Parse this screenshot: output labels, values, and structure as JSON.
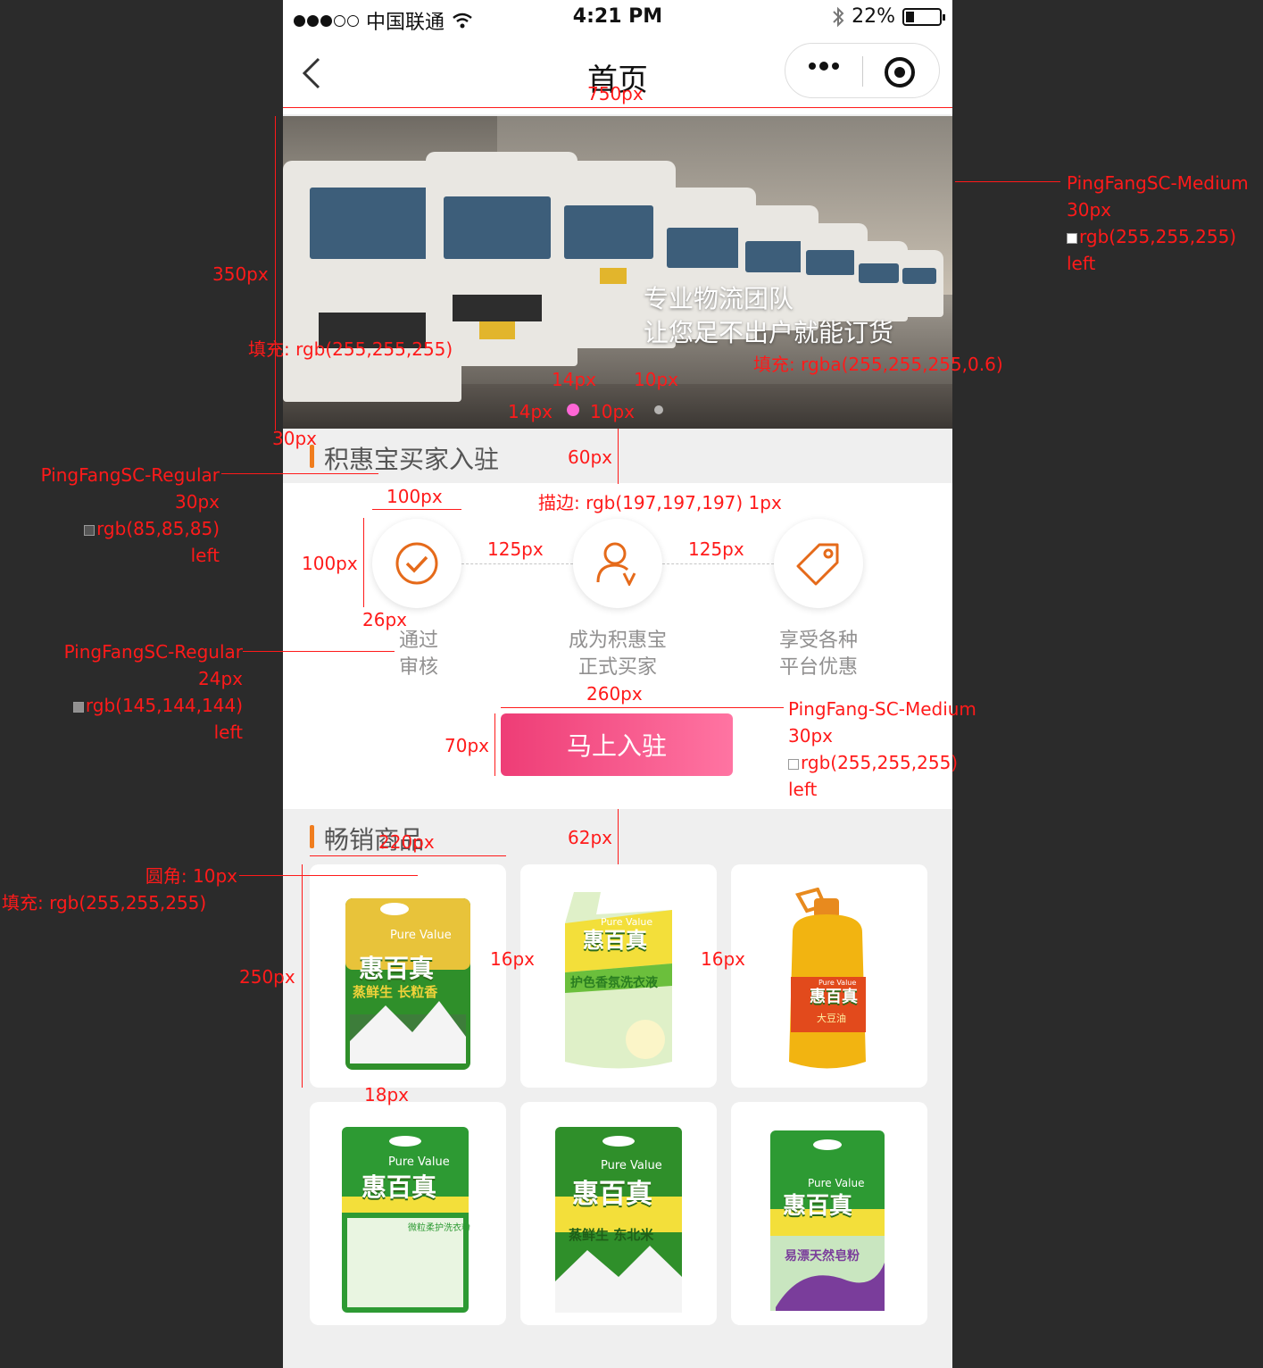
{
  "status_bar": {
    "carrier": "中国联通",
    "time": "4:21 PM",
    "battery": "22%"
  },
  "nav": {
    "title": "首页"
  },
  "banner": {
    "line1": "专业物流团队",
    "line2": "让您足不出户就能订货"
  },
  "join_section": {
    "title": "积惠宝买家入驻",
    "steps": [
      {
        "line1": "通过",
        "line2": "审核",
        "icon": "check-circle-icon"
      },
      {
        "line1": "成为积惠宝",
        "line2": "正式买家",
        "icon": "user-v-icon"
      },
      {
        "line1": "享受各种",
        "line2": "平台优惠",
        "icon": "tag-icon"
      }
    ],
    "button": "马上入驻"
  },
  "products_section": {
    "title": "畅销商品"
  },
  "products": [
    {
      "brand": "惠百真",
      "sub": "Pure Value",
      "name": "蒸鲜生 长粒香",
      "color": "#2f8f2a"
    },
    {
      "brand": "惠百真",
      "sub": "Pure Value",
      "name": "护色香氛洗衣液",
      "color": "#9fcf6b"
    },
    {
      "brand": "惠百真",
      "sub": "Pure Value",
      "name": "大豆油",
      "color": "#e0a21c"
    },
    {
      "brand": "惠百真",
      "sub": "Pure Value",
      "name": "微粒柔护洗衣粉",
      "color": "#2d9a33"
    },
    {
      "brand": "惠百真",
      "sub": "Pure Value",
      "name": "蒸鲜生 东北米",
      "color": "#2f8f2a"
    },
    {
      "brand": "惠百真",
      "sub": "Pure Value",
      "name": "易漂天然皂粉",
      "color": "#2d9a33"
    }
  ],
  "annotations": {
    "w750": "750px",
    "h350": "350px",
    "banner_font": [
      "PingFangSC-Medium",
      "30px",
      "rgb(255,255,255)",
      "left"
    ],
    "fill_white": "填充: rgb(255,255,255)",
    "fill_white_06": "填充: rgba(255,255,255,0.6)",
    "d14a": "14px",
    "d14b": "14px",
    "d10a": "10px",
    "d10b": "10px",
    "d30": "30px",
    "d60": "60px",
    "sec_font": [
      "PingFangSC-Regular",
      "30px",
      "rgb(85,85,85)",
      "left"
    ],
    "d100w": "100px",
    "d100h": "100px",
    "stroke": "描边: rgb(197,197,197) 1px",
    "d125a": "125px",
    "d125b": "125px",
    "d26": "26px",
    "step_font": [
      "PingFangSC-Regular",
      "24px",
      "rgb(145,144,144)",
      "left"
    ],
    "d260": "260px",
    "d70": "70px",
    "btn_font": [
      "PingFang-SC-Medium",
      "30px",
      "rgb(255,255,255)",
      "left"
    ],
    "d220": "220px",
    "d62": "62px",
    "radius": "圆角: 10px",
    "card_fill": "填充: rgb(255,255,255)",
    "d250": "250px",
    "d16a": "16px",
    "d16b": "16px",
    "d18": "18px"
  },
  "colors": {
    "accent": "#f07d1e",
    "button_start": "#ee3d76",
    "button_end": "#ff74a2",
    "annotation": "#ff1a1a"
  }
}
